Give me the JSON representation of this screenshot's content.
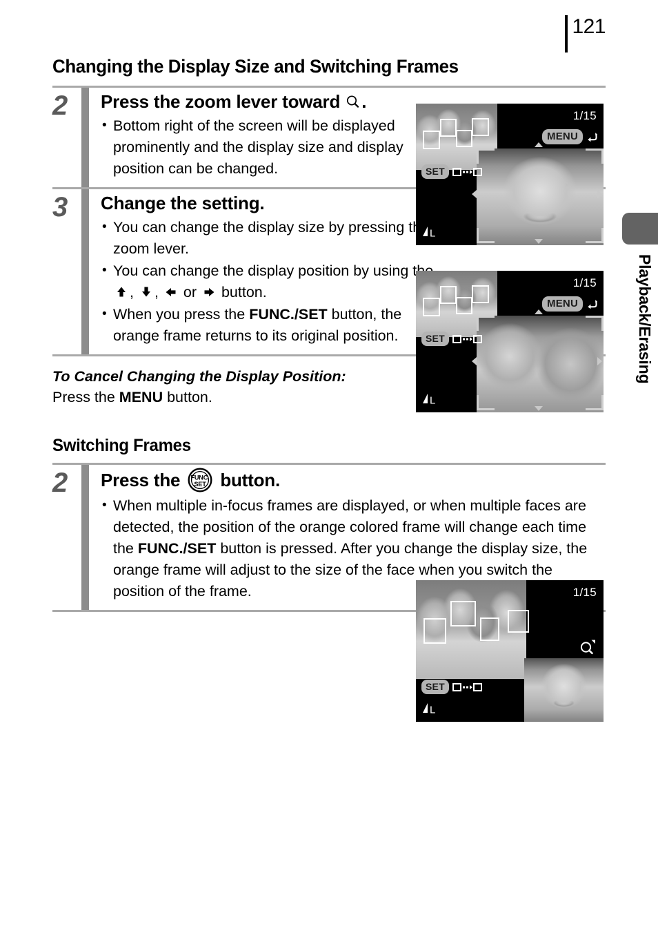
{
  "page": {
    "number": "121",
    "side_tab_label": "Playback/Erasing"
  },
  "headings": {
    "section_title": "Changing the Display Size and Switching Frames",
    "sub_title": "Switching Frames"
  },
  "steps": [
    {
      "number": "2",
      "heading_before_icon": "Press the zoom lever toward ",
      "heading_icon": "magnifier-icon",
      "heading_after_icon": ".",
      "bullets": [
        "Bottom right of the screen will be displayed prominently and the display size and display position can be changed."
      ]
    },
    {
      "number": "3",
      "heading": "Change the setting.",
      "bullets": [
        "You can change the display size by pressing the zoom lever.",
        "You can change the display position by using the  ,  ,   or   button.",
        "When you press the FUNC./SET button, the orange frame returns to its original position."
      ],
      "bullet2_parts": {
        "prefix": "You can change the display position by using the ",
        "icon_up": "arrow-up-icon",
        "sep1": ", ",
        "icon_down": "arrow-down-icon",
        "sep2": ", ",
        "icon_left": "arrow-left-icon",
        "mid": " or ",
        "icon_right": "arrow-right-icon",
        "suffix": " button."
      },
      "bullet3_parts": {
        "prefix": "When you press the ",
        "bold": "FUNC./SET",
        "suffix": " button, the orange frame returns to its original position."
      }
    },
    {
      "number": "2",
      "heading_before_icon": "Press the ",
      "heading_icon": "func-set-button-icon",
      "heading_after_icon": " button.",
      "bullet_parts": {
        "p1": "When multiple in-focus frames are displayed, or when multiple faces are detected, the position of the orange colored frame will change each time the ",
        "bold1": "FUNC./SET",
        "p2": " button is pressed. After you change the display size, the orange frame will adjust to the size of the face when you switch the position of the frame."
      }
    }
  ],
  "cancel_note": {
    "title": "To Cancel Changing the Display Position:",
    "text_before_bold": "Press the ",
    "bold": "MENU",
    "text_after_bold": " button."
  },
  "screenshots": [
    {
      "name": "lcd-zoomed-face-view",
      "counter": "1/15",
      "menu_label": "MENU",
      "set_label": "SET",
      "quality_label": "L"
    },
    {
      "name": "lcd-display-position-view",
      "counter": "1/15",
      "menu_label": "MENU",
      "set_label": "SET",
      "quality_label": "L"
    },
    {
      "name": "lcd-switching-frames-view",
      "counter": "1/15",
      "set_label": "SET",
      "quality_label": "L"
    }
  ],
  "colors": {
    "step_number": "#5a5a5a",
    "step_bar": "#8c8c8c",
    "rule": "#a9a9a9",
    "side_tab": "#636363",
    "osd_pill": "#b4b4b4"
  }
}
